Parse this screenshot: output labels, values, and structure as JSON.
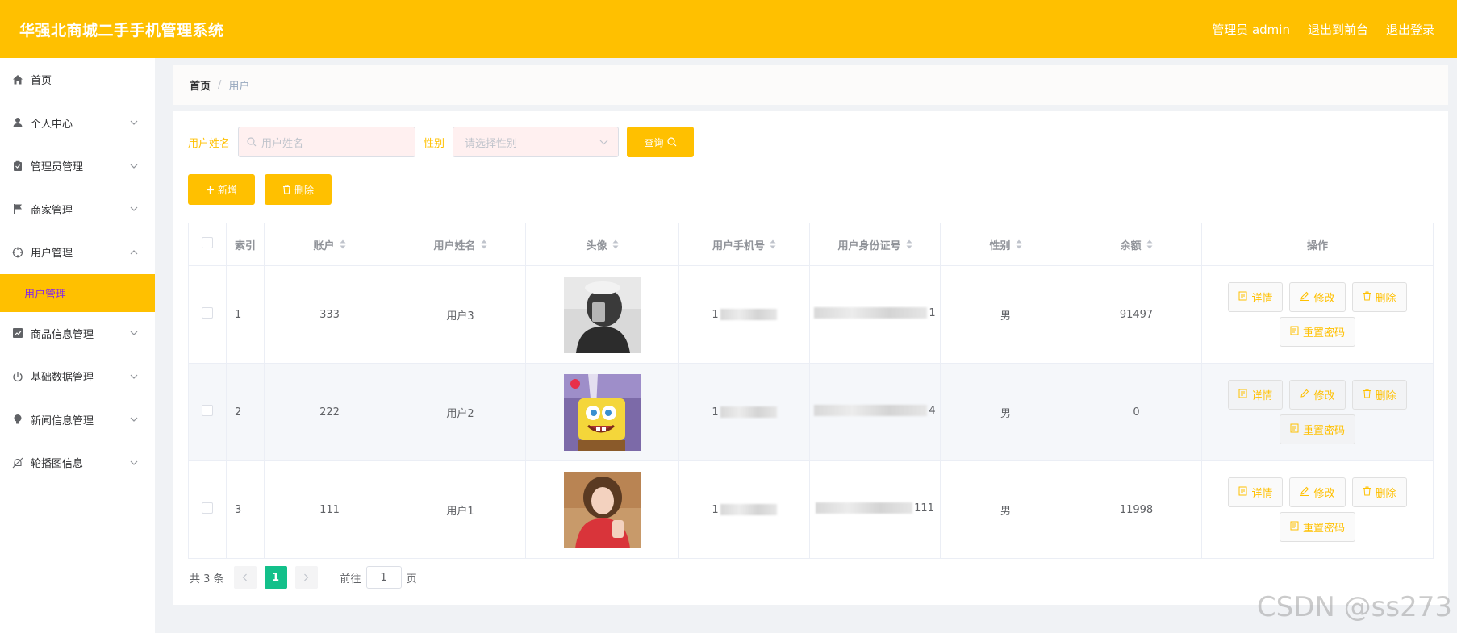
{
  "header": {
    "title": "华强北商城二手手机管理系统",
    "admin_label": "管理员 admin",
    "to_front_label": "退出到前台",
    "logout_label": "退出登录"
  },
  "sidebar": {
    "items": [
      {
        "label": "首页",
        "icon": "home-icon"
      },
      {
        "label": "个人中心",
        "icon": "user-icon"
      },
      {
        "label": "管理员管理",
        "icon": "clipboard-icon"
      },
      {
        "label": "商家管理",
        "icon": "flag-icon"
      },
      {
        "label": "用户管理",
        "icon": "crosshair-icon",
        "expanded": true
      },
      {
        "label": "商品信息管理",
        "icon": "chart-icon"
      },
      {
        "label": "基础数据管理",
        "icon": "power-icon"
      },
      {
        "label": "新闻信息管理",
        "icon": "bulb-icon"
      },
      {
        "label": "轮播图信息",
        "icon": "bell-off-icon"
      }
    ],
    "submenu_active": "用户管理"
  },
  "breadcrumb": {
    "home": "首页",
    "separator": "/",
    "current": "用户"
  },
  "search": {
    "name_label": "用户姓名",
    "name_placeholder": "用户姓名",
    "gender_label": "性别",
    "gender_placeholder": "请选择性别",
    "query_label": "查询"
  },
  "actions": {
    "add_label": "新增",
    "delete_label": "删除"
  },
  "table": {
    "columns": {
      "index": "索引",
      "account": "账户",
      "name": "用户姓名",
      "avatar": "头像",
      "phone": "用户手机号",
      "id_card": "用户身份证号",
      "gender": "性别",
      "balance": "余额",
      "ops": "操作"
    },
    "rows": [
      {
        "index": "1",
        "account": "333",
        "name": "用户3",
        "phone_prefix": "1",
        "phone_suffix": "",
        "id_suffix": "1",
        "gender": "男",
        "balance": "91497"
      },
      {
        "index": "2",
        "account": "222",
        "name": "用户2",
        "phone_prefix": "1",
        "phone_suffix": "",
        "id_suffix": "4",
        "gender": "男",
        "balance": "0"
      },
      {
        "index": "3",
        "account": "111",
        "name": "用户1",
        "phone_prefix": "1",
        "phone_suffix": "",
        "id_suffix": "111",
        "gender": "男",
        "balance": "11998"
      }
    ],
    "ops": {
      "detail": "详情",
      "edit": "修改",
      "delete": "删除",
      "reset": "重置密码"
    }
  },
  "pagination": {
    "total": "共 3 条",
    "current_page": "1",
    "goto_label": "前往",
    "goto_value": "1",
    "page_suffix": "页"
  },
  "watermark": "CSDN @ss273",
  "colors": {
    "accent": "#ffc000",
    "pagination_active": "#13c08a",
    "submenu_text": "#8a2be2"
  }
}
